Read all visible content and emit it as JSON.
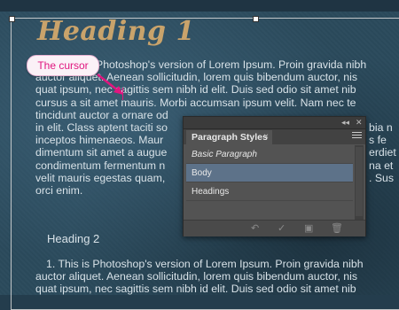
{
  "document": {
    "heading1": "Heading 1",
    "paragraph1_lines": [
      "Photoshop's version  of Lorem Ipsum. Proin gravida nibh",
      "auctor aliquet. Aenean sollicitudin, lorem quis bibendum auctor, nis",
      "quat ipsum, nec sagittis sem nibh id elit. Duis sed odio sit amet nib",
      "cursus a sit amet mauris. Morbi accumsan ipsum velit. Nam nec te",
      "tincidunt auctor a ornare od",
      "in elit. Class aptent taciti so",
      "inceptos himenaeos. Maur",
      "dimentum sit amet a augue",
      "condimentum fermentum n",
      "velit mauris egestas quam,",
      "orci enim."
    ],
    "paragraph1_right_fragments": [
      "",
      "",
      "",
      "",
      "",
      "bia n",
      "s fe",
      "erdiet",
      "na et",
      ". Sus",
      ""
    ],
    "heading2": "Heading 2",
    "paragraph2_lines": [
      "1. This is Photoshop's version  of Lorem Ipsum. Proin gravida nibh",
      "auctor aliquet. Aenean sollicitudin, lorem quis bibendum auctor, nis",
      "quat ipsum, nec sagittis sem nibh id elit. Duis sed odio sit amet nib"
    ]
  },
  "callout": {
    "label": "The cursor",
    "color": "#e0167f"
  },
  "panel": {
    "tab_label": "Paragraph Styles",
    "tab_close": "×",
    "collapse_label": "◂◂",
    "close_label": "✕",
    "items": [
      {
        "label": "Basic Paragraph",
        "italic": true,
        "selected": false
      },
      {
        "label": "Body",
        "italic": false,
        "selected": true
      },
      {
        "label": "Headings",
        "italic": false,
        "selected": false
      }
    ],
    "footer_icons": [
      "clear-overrides-icon",
      "redefine-style-icon",
      "new-style-icon",
      "delete-style-icon"
    ],
    "selection_color": "#5d7289"
  }
}
